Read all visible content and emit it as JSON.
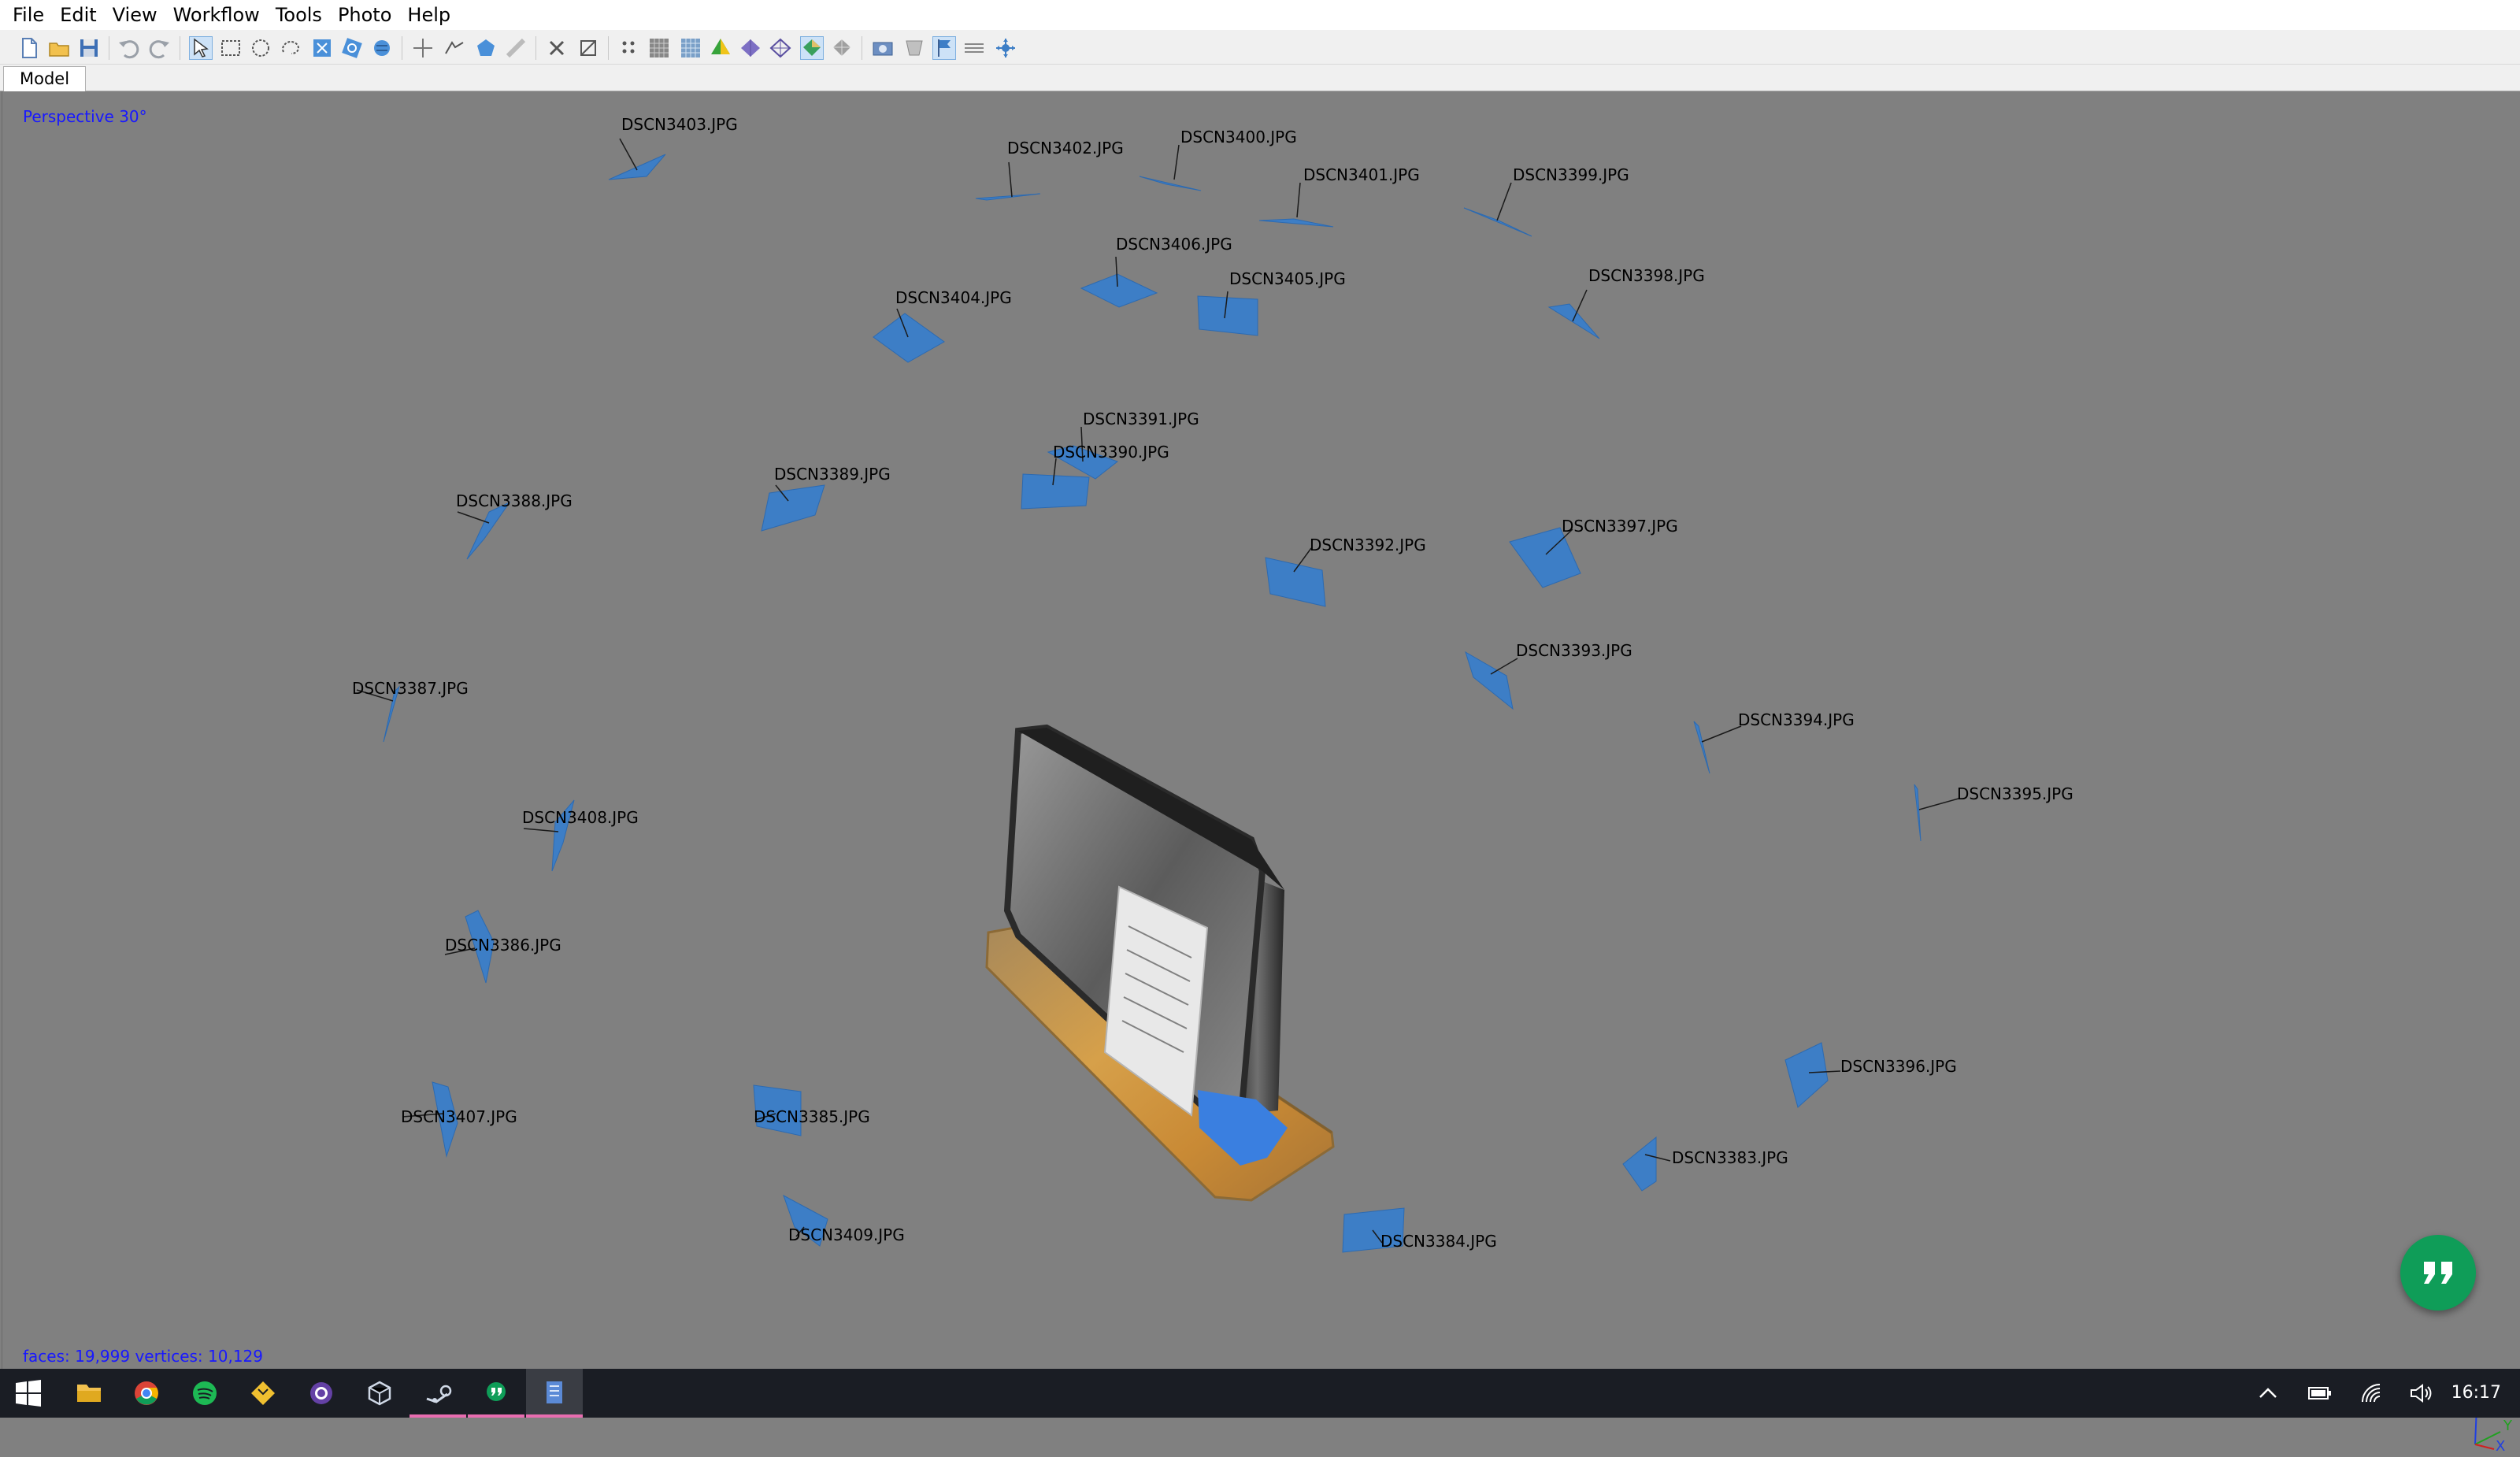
{
  "menu": [
    "File",
    "Edit",
    "View",
    "Workflow",
    "Tools",
    "Photo",
    "Help"
  ],
  "tabs": {
    "model": "Model"
  },
  "viewport": {
    "projection": "Perspective 30°",
    "stats": "faces: 19,999 vertices: 10,129"
  },
  "cameras": [
    "DSCN3403.JPG",
    "DSCN3402.JPG",
    "DSCN3400.JPG",
    "DSCN3401.JPG",
    "DSCN3399.JPG",
    "DSCN3406.JPG",
    "DSCN3405.JPG",
    "DSCN3404.JPG",
    "DSCN3398.JPG",
    "DSCN3391.JPG",
    "DSCN3390.JPG",
    "DSCN3389.JPG",
    "DSCN3388.JPG",
    "DSCN3397.JPG",
    "DSCN3392.JPG",
    "DSCN3393.JPG",
    "DSCN3387.JPG",
    "DSCN3394.JPG",
    "DSCN3395.JPG",
    "DSCN3408.JPG",
    "DSCN3386.JPG",
    "DSCN3396.JPG",
    "DSCN3407.JPG",
    "DSCN3385.JPG",
    "DSCN3383.JPG",
    "DSCN3409.JPG",
    "DSCN3384.JPG"
  ],
  "axis": {
    "z": "Z",
    "y": "Y",
    "x": "X"
  },
  "taskbar": {
    "clock": "16:17"
  },
  "colors": {
    "viewport_bg": "#808080",
    "camera_plane": "#3d7ec6",
    "label_blue": "#1818ff",
    "taskbar_bg": "#1a1d24",
    "fab_green": "#0f9d58"
  },
  "icons": {
    "toolbar": [
      "new-project-icon",
      "open-icon",
      "save-icon",
      "undo-icon",
      "redo-icon",
      "navigation-icon",
      "rectangle-select-icon",
      "circle-select-icon",
      "free-form-select-icon",
      "resize-region-icon",
      "rotate-region-icon",
      "rotate-object-icon",
      "ruler-icon",
      "polygon-icon",
      "measure-icon",
      "delete-selection-icon",
      "crop-selection-icon",
      "point-cloud-icon",
      "dense-cloud-icon",
      "dense-cloud-classes-icon",
      "shaded-model-icon",
      "solid-model-icon",
      "wireframe-icon",
      "textured-model-icon",
      "tiled-model-icon",
      "show-cameras-icon",
      "show-shapes-icon",
      "show-markers-icon",
      "show-region-icon",
      "show-trackball-icon"
    ],
    "taskbar": [
      "windows-start-icon",
      "file-explorer-icon",
      "chrome-icon",
      "spotify-icon",
      "git-icon",
      "twitch-icon",
      "virtualbox-icon",
      "steam-icon",
      "hangouts-icon",
      "photoscan-icon"
    ],
    "tray": [
      "show-hidden-icons-icon",
      "battery-icon",
      "wifi-icon",
      "volume-icon"
    ]
  }
}
